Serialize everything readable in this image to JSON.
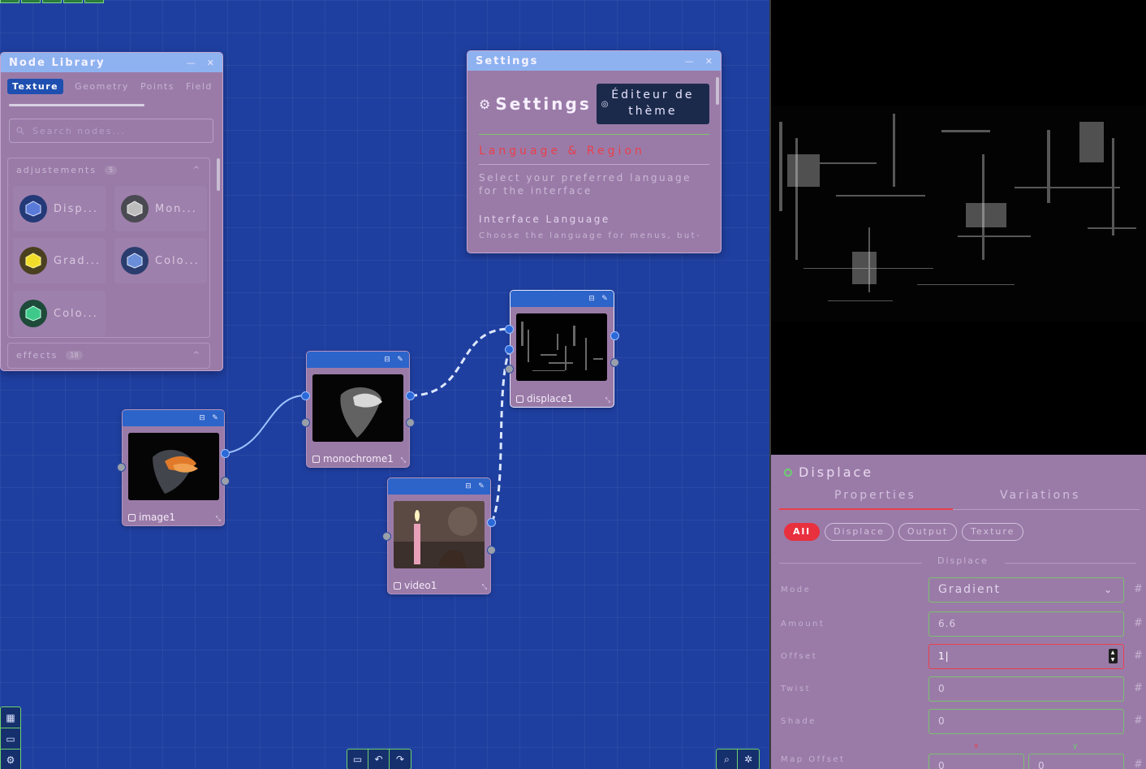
{
  "node_library": {
    "title": "Node Library",
    "tabs": [
      "Texture",
      "Geometry",
      "Points",
      "Field"
    ],
    "search_placeholder": "Search nodes...",
    "sections": [
      {
        "name": "adjustements",
        "count": "5",
        "items": [
          "Disp...",
          "Mon...",
          "Grad...",
          "Colo...",
          "Colo..."
        ]
      },
      {
        "name": "effects",
        "count": "18"
      }
    ]
  },
  "settings": {
    "title": "Settings",
    "heading": "Settings",
    "theme_button": "Éditeur de thème",
    "section_title": "Language & Region",
    "section_desc": "Select your preferred language for the interface",
    "sub_title": "Interface Language",
    "sub_desc": "Choose the language for menus, but-"
  },
  "nodes": [
    {
      "id": "image1",
      "label": "image1"
    },
    {
      "id": "monochrome1",
      "label": "monochrome1"
    },
    {
      "id": "displace1",
      "label": "displace1"
    },
    {
      "id": "video1",
      "label": "video1"
    }
  ],
  "properties": {
    "title": "Displace",
    "tabs": [
      "Properties",
      "Variations"
    ],
    "filters": [
      "All",
      "Displace",
      "Output",
      "Texture"
    ],
    "group": "Displace",
    "rows": [
      {
        "label": "Mode",
        "value": "Gradient"
      },
      {
        "label": "Amount",
        "value": "6.6"
      },
      {
        "label": "Offset",
        "value": "1"
      },
      {
        "label": "Twist",
        "value": "0"
      },
      {
        "label": "Shade",
        "value": "0"
      },
      {
        "label": "Map Offset",
        "x": "0",
        "y": "0",
        "x_label": "x",
        "y_label": "y"
      }
    ]
  },
  "colors": {
    "canvas": "#1f3fa0",
    "panel": "#9a7ba8",
    "node_header": "#2d64c9",
    "accent_red": "#e8404a",
    "accent_green": "#6cd16f"
  },
  "toolbar": {
    "bottom_center": [
      "save-icon",
      "undo-icon",
      "redo-icon"
    ],
    "bottom_right": [
      "search-icon",
      "bug-icon"
    ],
    "left": [
      "layout-icon",
      "save-icon",
      "gear-icon"
    ]
  }
}
